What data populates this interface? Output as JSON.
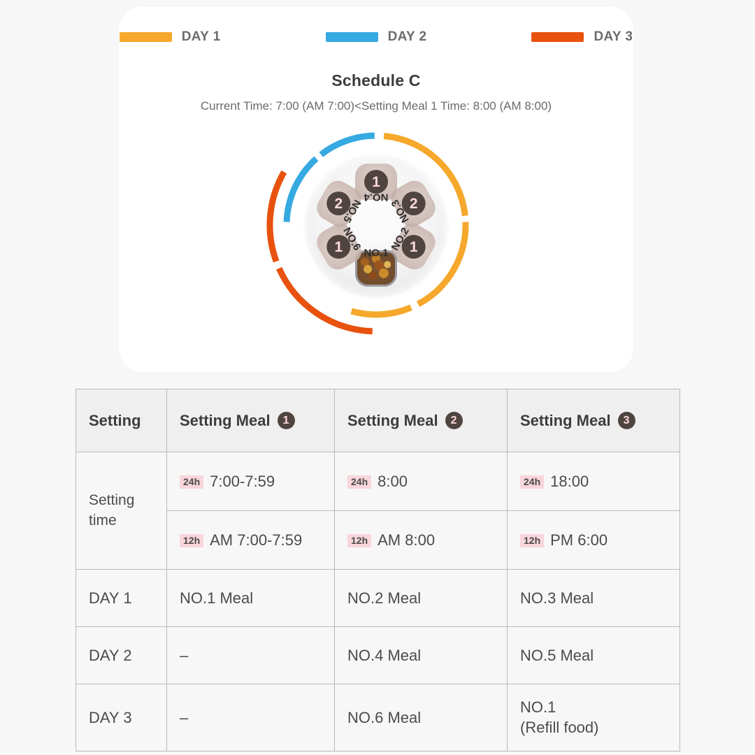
{
  "legend": {
    "items": [
      {
        "label": "DAY 1",
        "color": "#f5a82b",
        "name": "day-1"
      },
      {
        "label": "DAY 2",
        "color": "#36a9e1",
        "name": "day-2"
      },
      {
        "label": "DAY 3",
        "color": "#e8520e",
        "name": "day-3"
      }
    ]
  },
  "card": {
    "title": "Schedule C",
    "subtitle": "Current Time: 7:00 (AM 7:00)<Setting Meal 1 Time: 8:00 (AM 8:00)"
  },
  "wheel": {
    "compartments": [
      {
        "label": "NO.4",
        "badge": "1",
        "angle": 0,
        "filled": false
      },
      {
        "label": "NO.3",
        "badge": "2",
        "angle": 60,
        "filled": false
      },
      {
        "label": "NO.2",
        "badge": "1",
        "angle": 120,
        "filled": false
      },
      {
        "label": "NO.1",
        "badge": "",
        "angle": 180,
        "filled": true
      },
      {
        "label": "NO.6",
        "badge": "1",
        "angle": 240,
        "filled": false
      },
      {
        "label": "NO.5",
        "badge": "2",
        "angle": 300,
        "filled": false
      }
    ],
    "arcs": [
      {
        "name": "day-2-arc-inner-upper-left",
        "color": "#36a9e1",
        "ring": "inner",
        "start": 272,
        "end": 318
      },
      {
        "name": "day-2-arc-inner-top",
        "color": "#36a9e1",
        "ring": "inner",
        "start": 322,
        "end": 359
      },
      {
        "name": "day-1-arc-inner-upper-right",
        "color": "#f5a82b",
        "ring": "inner",
        "start": 5,
        "end": 84
      },
      {
        "name": "day-1-arc-inner-lower-right",
        "color": "#f5a82b",
        "ring": "inner",
        "start": 88,
        "end": 152
      },
      {
        "name": "day-1-arc-inner-bottom",
        "color": "#f5a82b",
        "ring": "inner",
        "start": 157,
        "end": 196
      },
      {
        "name": "day-3-arc-outer-left",
        "color": "#e8520e",
        "ring": "outer",
        "start": 250,
        "end": 300
      },
      {
        "name": "day-3-arc-outer-bottom",
        "color": "#e8520e",
        "ring": "outer",
        "start": 182,
        "end": 246
      }
    ]
  },
  "table": {
    "headers": [
      {
        "text": "Setting",
        "circle": ""
      },
      {
        "text": "Setting Meal",
        "circle": "1"
      },
      {
        "text": "Setting Meal",
        "circle": "2"
      },
      {
        "text": "Setting Meal",
        "circle": "3"
      }
    ],
    "setting_time_label": "Setting\ntime",
    "rows_24h": [
      {
        "badge": "24h",
        "value": "7:00-7:59"
      },
      {
        "badge": "24h",
        "value": "8:00"
      },
      {
        "badge": "24h",
        "value": "18:00"
      }
    ],
    "rows_12h": [
      {
        "badge": "12h",
        "value": "AM 7:00-7:59"
      },
      {
        "badge": "12h",
        "value": "AM 8:00"
      },
      {
        "badge": "12h",
        "value": "PM 6:00"
      }
    ],
    "day_rows": [
      {
        "label": "DAY 1",
        "cells": [
          "NO.1 Meal",
          "NO.2 Meal",
          "NO.3 Meal"
        ]
      },
      {
        "label": "DAY 2",
        "cells": [
          "–",
          "NO.4 Meal",
          "NO.5 Meal"
        ]
      },
      {
        "label": "DAY 3",
        "cells": [
          "–",
          "NO.6 Meal",
          "NO.1\n(Refill food)"
        ]
      }
    ]
  },
  "colors": {
    "day1": "#f5a82b",
    "day2": "#36a9e1",
    "day3": "#e8520e",
    "badge_bg": "#f9d6dc",
    "circle_bg": "#4f4440",
    "page_bg": "#f7f7f7"
  }
}
